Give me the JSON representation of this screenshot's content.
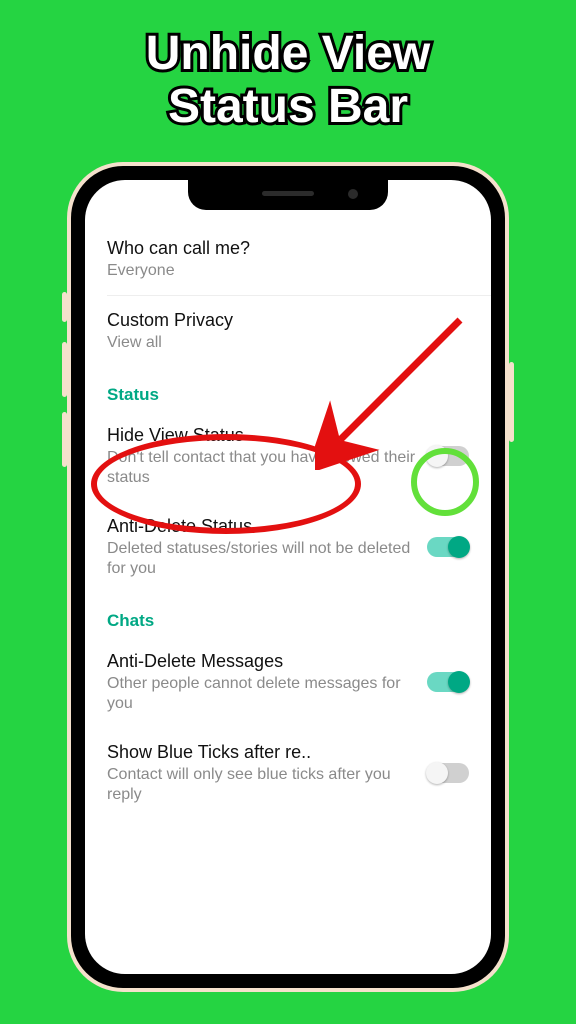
{
  "title_line1": "Unhide View",
  "title_line2": "Status Bar",
  "rows": {
    "call": {
      "title": "Who can call me?",
      "sub": "Everyone"
    },
    "custom": {
      "title": "Custom Privacy",
      "sub": "View all"
    }
  },
  "sections": {
    "status": "Status",
    "chats": "Chats"
  },
  "status_rows": {
    "hide_view": {
      "title": "Hide View Status",
      "sub": "Don't tell contact that you have viewed their status"
    },
    "anti_delete_status": {
      "title": "Anti-Delete Status",
      "sub": "Deleted statuses/stories will not be deleted for you"
    }
  },
  "chats_rows": {
    "anti_delete_msg": {
      "title": "Anti-Delete Messages",
      "sub": "Other people cannot delete messages for you"
    },
    "blue_ticks": {
      "title": "Show Blue Ticks after re..",
      "sub": "Contact will only see blue ticks after you reply"
    }
  }
}
